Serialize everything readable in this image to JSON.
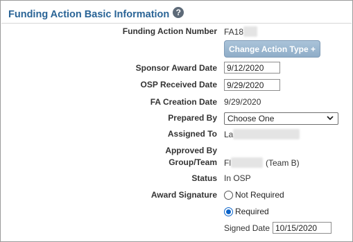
{
  "section": {
    "title": "Funding Action Basic Information",
    "help_icon": "?"
  },
  "fields": {
    "funding_action_number": {
      "label": "Funding Action Number",
      "value": "FA18"
    },
    "change_action_type_button": "Change Action Type +",
    "sponsor_award_date": {
      "label": "Sponsor Award Date",
      "value": "9/12/2020"
    },
    "osp_received_date": {
      "label": "OSP Received Date",
      "value": "9/29/2020"
    },
    "fa_creation_date": {
      "label": "FA Creation Date",
      "value": "9/29/2020"
    },
    "prepared_by": {
      "label": "Prepared By",
      "selected": "Choose One"
    },
    "assigned_to": {
      "label": "Assigned To",
      "value": "La"
    },
    "approved_by": {
      "label": "Approved By"
    },
    "group_team": {
      "label": "Group/Team",
      "value": "Fl",
      "suffix": "(Team B)"
    },
    "status": {
      "label": "Status",
      "value": "In OSP"
    },
    "award_signature": {
      "label": "Award Signature",
      "options": [
        {
          "label": "Not Required",
          "checked": false
        },
        {
          "label": "Required",
          "checked": true
        }
      ],
      "signed_date_label": "Signed Date",
      "signed_date_value": "10/15/2020"
    }
  },
  "colors": {
    "title": "#2a6496",
    "button_bg": "#9fb9d2",
    "radio_checked": "#0b63c9"
  }
}
